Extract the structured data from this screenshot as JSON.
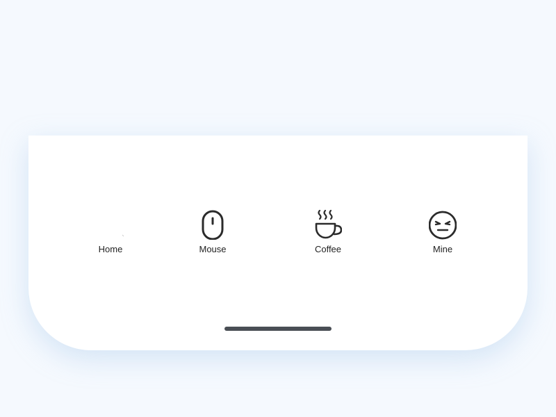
{
  "theme": {
    "background": "#f5f9fe",
    "card": "#ffffff",
    "icon_stroke": "#2b2b2b",
    "indicator": "#4a4e55"
  },
  "tabbar": {
    "tabs": [
      {
        "id": "home",
        "label": "Home",
        "icon": "home-icon"
      },
      {
        "id": "mouse",
        "label": "Mouse",
        "icon": "mouse-icon"
      },
      {
        "id": "coffee",
        "label": "Coffee",
        "icon": "coffee-icon"
      },
      {
        "id": "mine",
        "label": "Mine",
        "icon": "face-icon"
      }
    ]
  }
}
